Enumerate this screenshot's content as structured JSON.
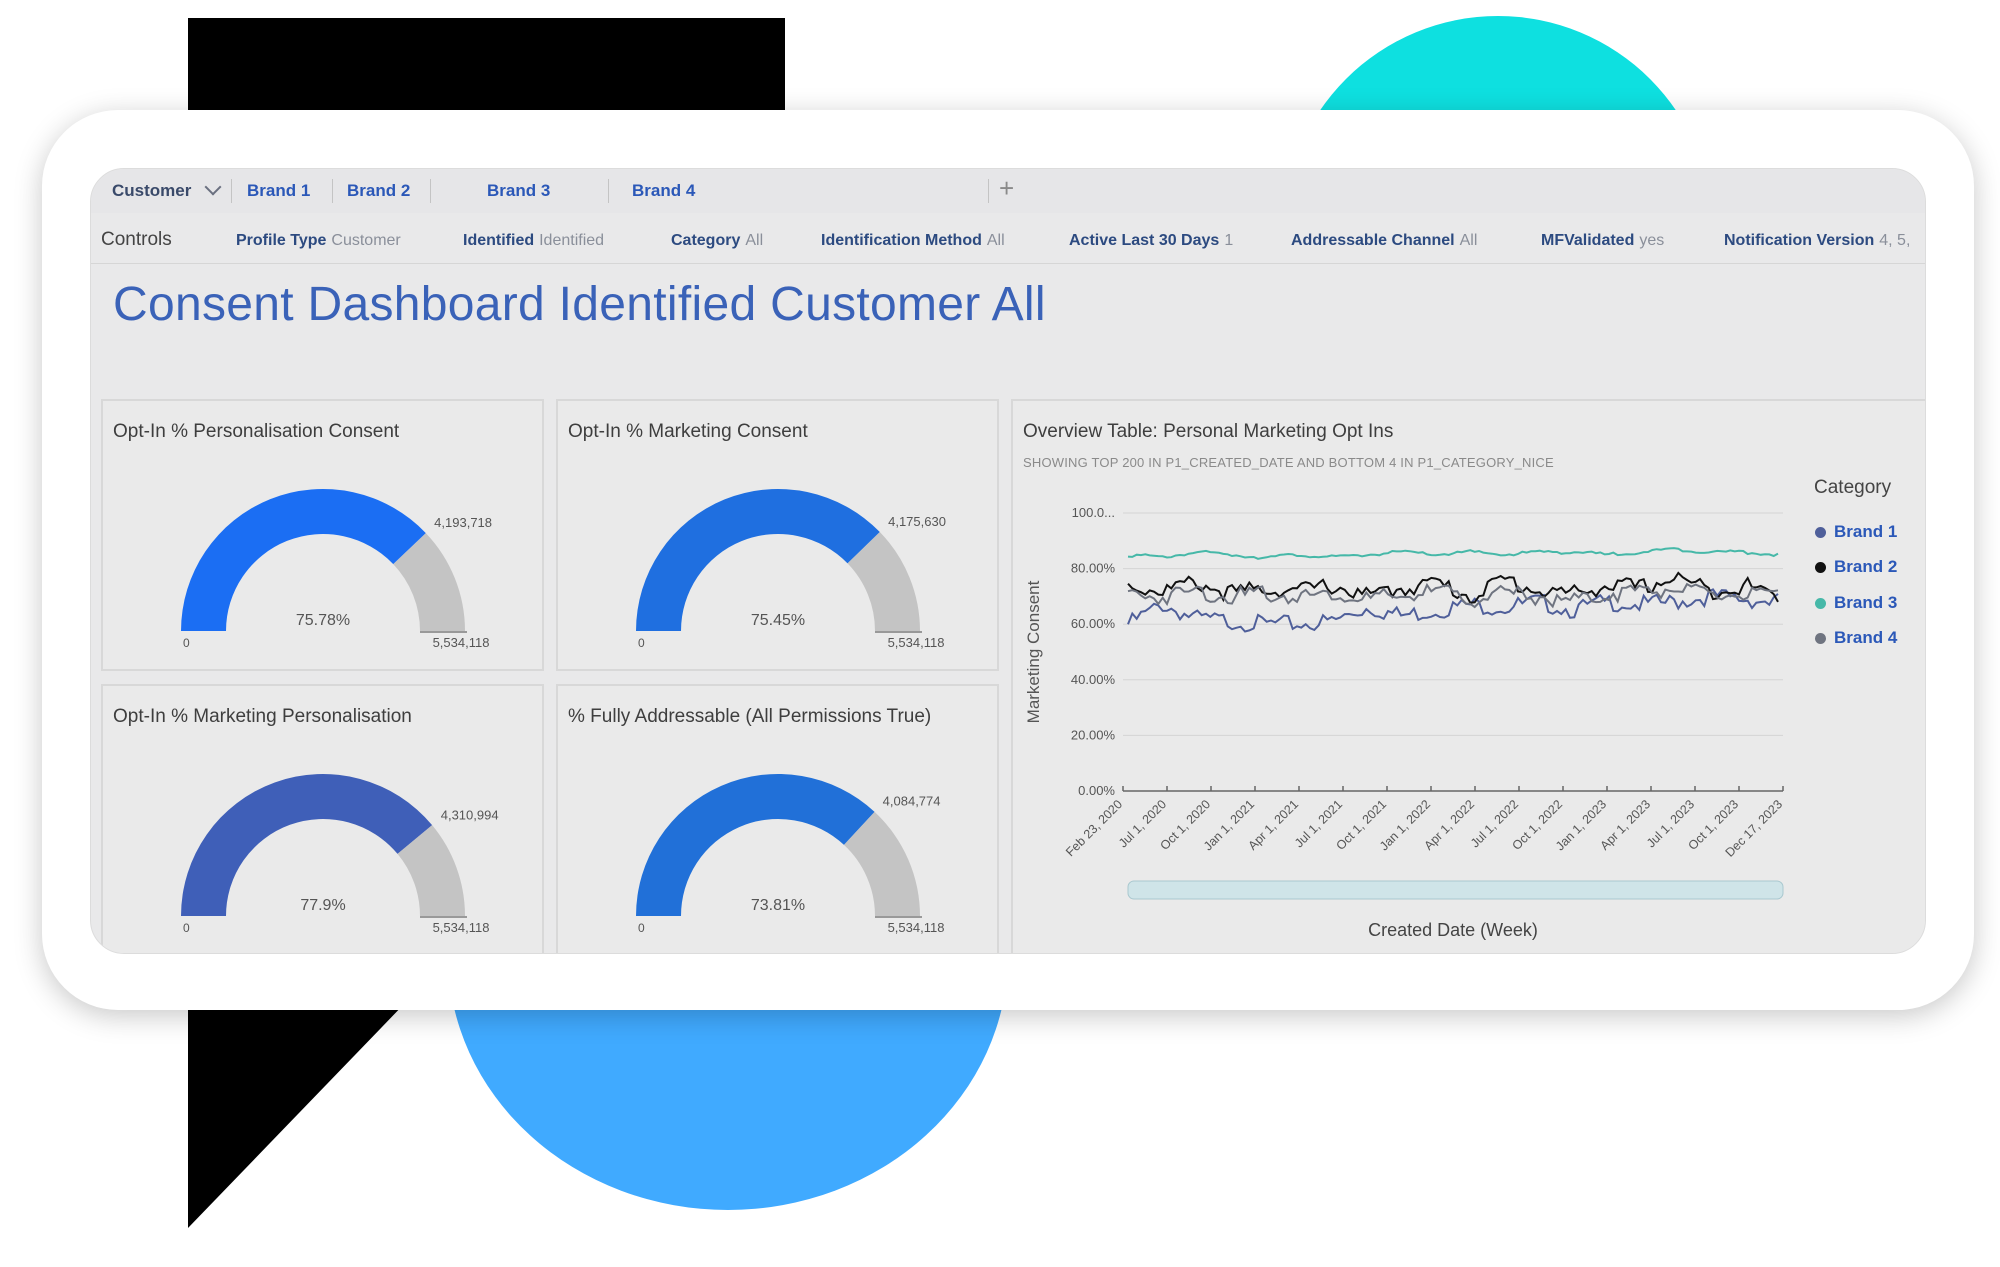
{
  "tabs": {
    "active": "Customer",
    "items": [
      "Brand 1",
      "Brand 2",
      "Brand 3",
      "Brand 4"
    ],
    "add_symbol": "+"
  },
  "controls": {
    "label": "Controls",
    "filters": [
      {
        "label": "Profile Type",
        "value": "Customer"
      },
      {
        "label": "Identified",
        "value": "Identified"
      },
      {
        "label": "Category",
        "value": "All"
      },
      {
        "label": "Identification Method",
        "value": "All"
      },
      {
        "label": "Active Last 30 Days",
        "value": "1"
      },
      {
        "label": "Addressable Channel",
        "value": "All"
      },
      {
        "label": "MFValidated",
        "value": "yes"
      },
      {
        "label": "Notification Version",
        "value": "4, 5,"
      }
    ]
  },
  "page_title": "Consent Dashboard Identified Customer All",
  "gauges": [
    {
      "title": "Opt-In % Personalisation Consent",
      "percent_label": "75.78%",
      "percent": 75.78,
      "value": "4,193,718",
      "min": "0",
      "max": "5,534,118",
      "color": "#1b6ef3"
    },
    {
      "title": "Opt-In % Marketing Consent",
      "percent_label": "75.45%",
      "percent": 75.45,
      "value": "4,175,630",
      "min": "0",
      "max": "5,534,118",
      "color": "#1f6fe0"
    },
    {
      "title": "Opt-In % Marketing Personalisation",
      "percent_label": "77.9%",
      "percent": 77.9,
      "value": "4,310,994",
      "min": "0",
      "max": "5,534,118",
      "color": "#3f5fb8"
    },
    {
      "title": "% Fully Addressable (All Permissions True)",
      "percent_label": "73.81%",
      "percent": 73.81,
      "value": "4,084,774",
      "min": "0",
      "max": "5,534,118",
      "color": "#2170d8"
    }
  ],
  "chart": {
    "title": "Overview Table: Personal Marketing Opt Ins",
    "subtitle": "SHOWING TOP 200 IN P1_CREATED_DATE AND BOTTOM 4 IN P1_CATEGORY_NICE",
    "legend_title": "Category"
  },
  "colors": {
    "brand1": "#4f5f9a",
    "brand2": "#111111",
    "brand3": "#46b8a8",
    "brand4": "#6f7480",
    "gauge_remainder": "#c4c4c4"
  },
  "chart_data": {
    "type": "line",
    "xlabel": "Created Date (Week)",
    "ylabel": "Marketing Consent",
    "y_ticks": [
      "0.00%",
      "20.00%",
      "40.00%",
      "60.00%",
      "80.00%",
      "100.0..."
    ],
    "ylim": [
      0,
      100
    ],
    "x_ticks": [
      "Feb 23, 2020",
      "Jul 1, 2020",
      "Oct 1, 2020",
      "Jan 1, 2021",
      "Apr 1, 2021",
      "Jul 1, 2021",
      "Oct 1, 2021",
      "Jan 1, 2022",
      "Apr 1, 2022",
      "Jul 1, 2022",
      "Oct 1, 2022",
      "Jan 1, 2023",
      "Apr 1, 2023",
      "Jul 1, 2023",
      "Oct 1, 2023",
      "Dec 17, 2023"
    ],
    "legend_position": "right",
    "series": [
      {
        "name": "Brand 1",
        "color": "#4f5f9a",
        "values": [
          60,
          67,
          62,
          61,
          60,
          60,
          61,
          66,
          63,
          65,
          67,
          66,
          68,
          65,
          68,
          67,
          68,
          70,
          69,
          68
        ]
      },
      {
        "name": "Brand 2",
        "color": "#111111",
        "values": [
          74,
          72,
          75,
          71,
          73,
          72,
          74,
          70,
          73,
          75,
          70,
          76,
          72,
          71,
          74,
          73,
          77,
          72,
          74,
          70
        ]
      },
      {
        "name": "Brand 3",
        "color": "#46b8a8",
        "values": [
          85,
          84,
          86,
          85,
          84,
          85,
          84,
          85,
          86,
          85,
          86,
          85,
          86,
          86,
          85,
          86,
          87,
          86,
          86,
          85
        ]
      },
      {
        "name": "Brand 4",
        "color": "#6f7480",
        "values": [
          71,
          70,
          72,
          70,
          71,
          70,
          71,
          69,
          70,
          72,
          69,
          71,
          70,
          68,
          71,
          72,
          73,
          70,
          71,
          69
        ]
      }
    ]
  }
}
